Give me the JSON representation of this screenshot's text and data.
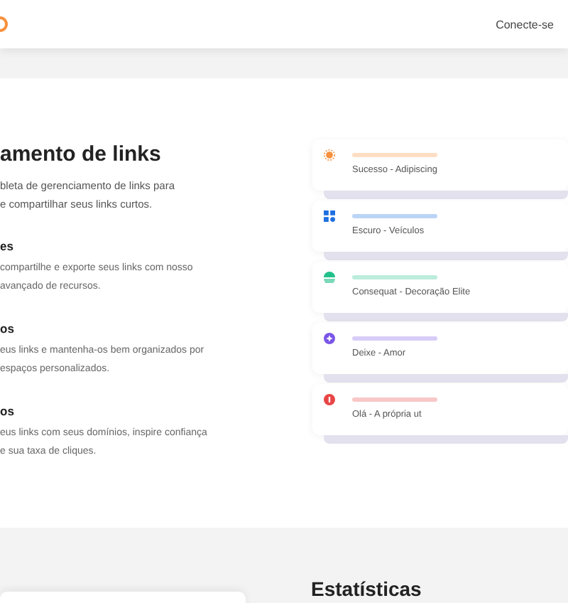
{
  "header": {
    "login": "Conecte-se"
  },
  "hero": {
    "title": "amento de links",
    "description": [
      "bleta de gerenciamento de links para",
      "e compartilhar seus links curtos."
    ]
  },
  "features": [
    {
      "title": "es",
      "lines": [
        "compartilhe e exporte seus links com nosso",
        "avançado de recursos."
      ]
    },
    {
      "title": "os",
      "lines": [
        "eus links e mantenha-os bem organizados por",
        "espaços personalizados."
      ]
    },
    {
      "title": "os",
      "lines": [
        "eus links com seus domínios, inspire confiança",
        "e sua taxa de cliques."
      ]
    }
  ],
  "links": [
    {
      "subtitle": "Sucesso - Adipiscing",
      "color": "#f7913d",
      "kind": "sun"
    },
    {
      "subtitle": "Escuro - Veículos",
      "color": "#1f6fe0",
      "kind": "grid"
    },
    {
      "subtitle": "Consequat - Decoração Elite",
      "color": "#22c08a",
      "kind": "leaf"
    },
    {
      "subtitle": "Deixe - Amor",
      "color": "#7a55e8",
      "kind": "star"
    },
    {
      "subtitle": "Olá - A própria ut",
      "color": "#e84545",
      "kind": "dot"
    }
  ],
  "stats": {
    "title": "Estatísticas"
  }
}
